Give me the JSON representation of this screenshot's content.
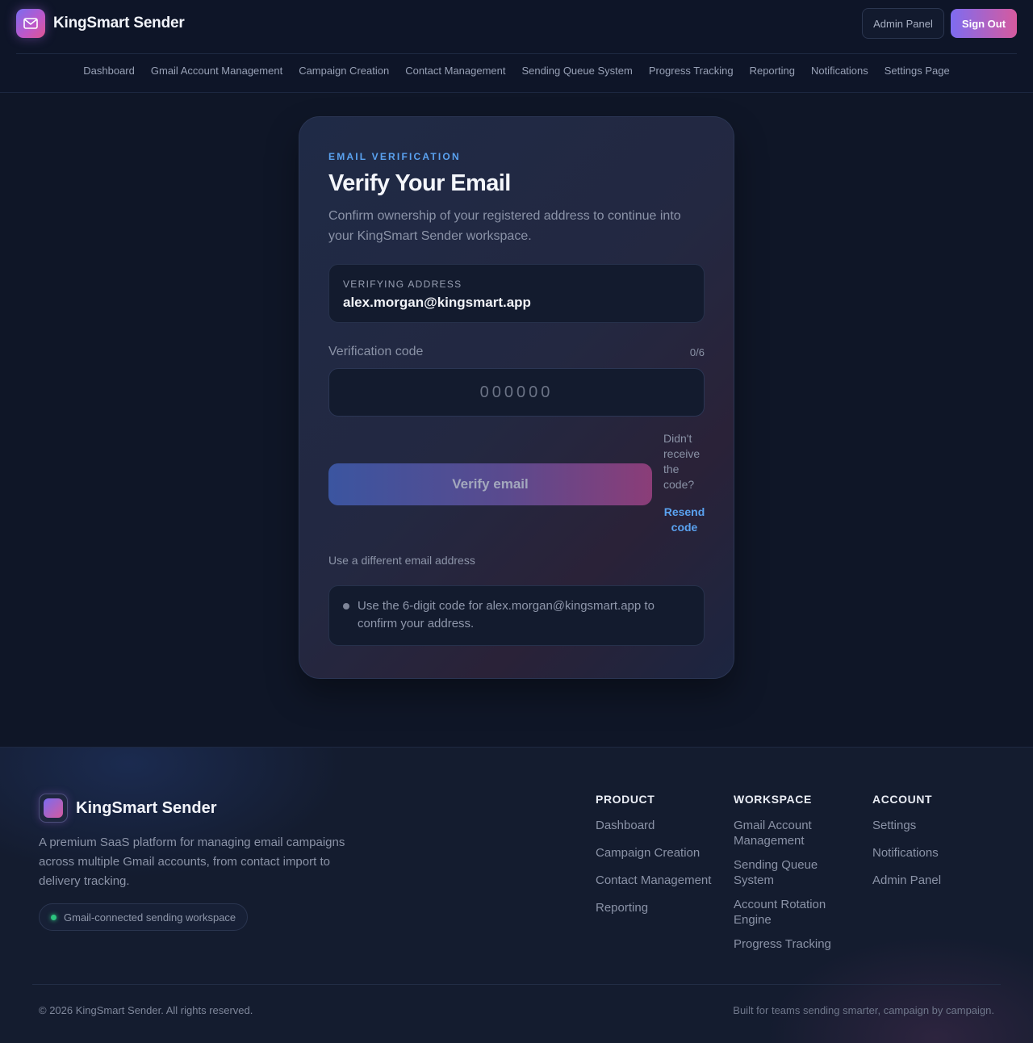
{
  "header": {
    "brand_name": "KingSmart Sender",
    "logo_icon": "mail-icon",
    "admin_label": "Admin Panel",
    "signout_label": "Sign Out"
  },
  "nav": {
    "items": [
      {
        "label": "Dashboard"
      },
      {
        "label": "Gmail Account Management"
      },
      {
        "label": "Campaign Creation"
      },
      {
        "label": "Contact Management"
      },
      {
        "label": "Sending Queue System"
      },
      {
        "label": "Progress Tracking"
      },
      {
        "label": "Reporting"
      },
      {
        "label": "Notifications"
      },
      {
        "label": "Settings Page"
      }
    ]
  },
  "card": {
    "eyebrow": "EMAIL VERIFICATION",
    "title": "Verify Your Email",
    "subtitle": "Confirm ownership of your registered address to continue into your KingSmart Sender workspace.",
    "address_label": "VERIFYING ADDRESS",
    "address_value": "alex.morgan@kingsmart.app",
    "code_label": "Verification code",
    "code_count": "0/6",
    "code_value": "",
    "code_placeholder": "000000",
    "verify_label": "Verify email",
    "resend_question": "Didn't receive the code?",
    "resend_label": "Resend code",
    "different_email_label": "Use a different email address",
    "hint_text": "Use the 6-digit code for alex.morgan@kingsmart.app to confirm your address."
  },
  "footer": {
    "brand_name": "KingSmart Sender",
    "description": "A premium SaaS platform for managing email campaigns across multiple Gmail accounts, from contact import to delivery tracking.",
    "pill_label": "Gmail-connected sending workspace",
    "columns": {
      "product": {
        "heading": "PRODUCT",
        "links": [
          "Dashboard",
          "Campaign Creation",
          "Contact Management",
          "Reporting"
        ]
      },
      "workspace": {
        "heading": "WORKSPACE",
        "links": [
          "Gmail Account Management",
          "Sending Queue System",
          "Account Rotation Engine",
          "Progress Tracking"
        ]
      },
      "account": {
        "heading": "ACCOUNT",
        "links": [
          "Settings",
          "Notifications",
          "Admin Panel"
        ]
      }
    },
    "copyright": "© 2026 KingSmart Sender. All rights reserved.",
    "tagline": "Built for teams sending smarter, campaign by campaign."
  },
  "colors": {
    "accent_blue": "#5aa2f0",
    "brand_gradient_start": "#7e6cf0",
    "brand_gradient_end": "#d65a9e",
    "status_green": "#2cc47e"
  }
}
